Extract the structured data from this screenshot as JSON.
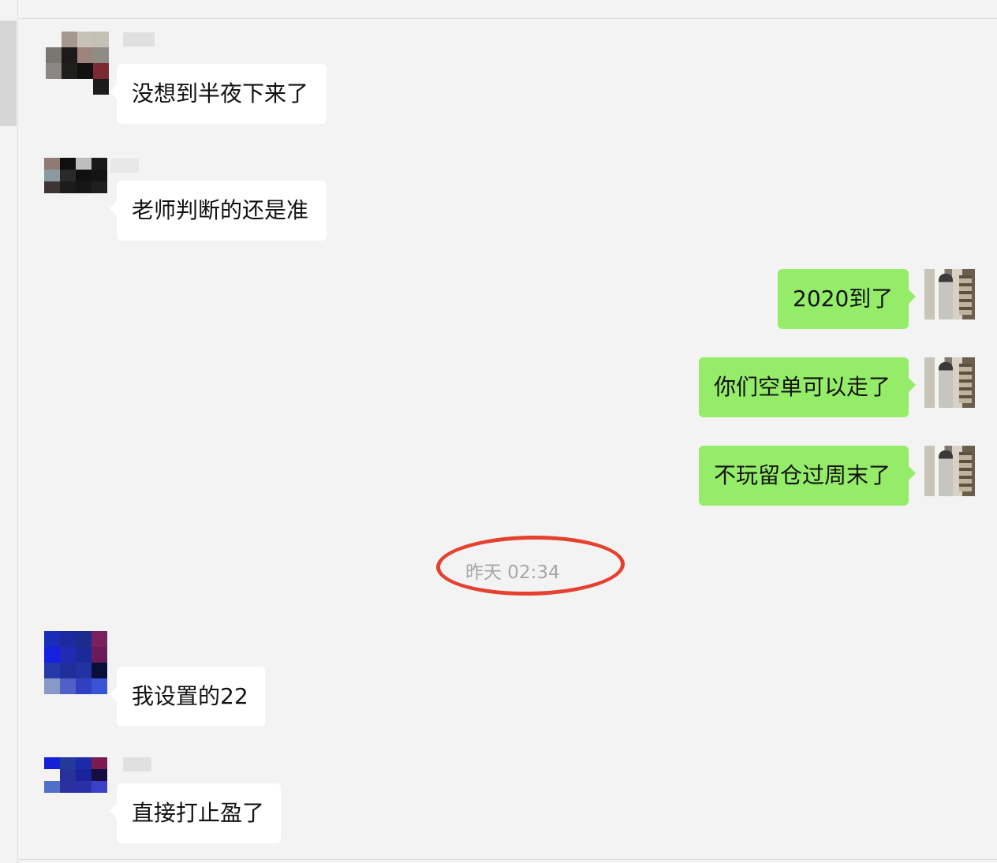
{
  "chat": {
    "timestamp": "昨天 02:34",
    "highlight_color": "#e5412f",
    "messages": [
      {
        "side": "incoming",
        "text": "没想到半夜下来了"
      },
      {
        "side": "incoming",
        "text": "老师判断的还是准"
      },
      {
        "side": "outgoing",
        "text": "2020到了"
      },
      {
        "side": "outgoing",
        "text": "你们空单可以走了"
      },
      {
        "side": "outgoing",
        "text": "不玩留仓过周末了"
      },
      {
        "side": "incoming",
        "text": "我设置的22"
      },
      {
        "side": "incoming",
        "text": "直接打止盈了"
      }
    ]
  },
  "colors": {
    "incoming_bubble": "#ffffff",
    "outgoing_bubble": "#95ec69",
    "background": "#f3f3f3"
  }
}
